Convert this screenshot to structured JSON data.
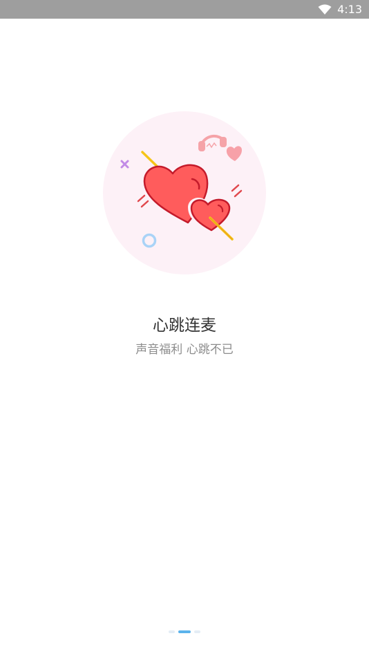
{
  "status_bar": {
    "time": "4:13",
    "icons": [
      "wifi-icon"
    ],
    "background": "#9e9e9e"
  },
  "onboarding": {
    "title": "心跳连麦",
    "subtitle": "声音福利 心跳不已",
    "illustration_icons": [
      "heart-icon",
      "headphones-icon"
    ],
    "accent_color": "#ff5c5c"
  },
  "pager": {
    "page_count": 3,
    "current_page": 2,
    "active_color": "#5bb3ec"
  }
}
